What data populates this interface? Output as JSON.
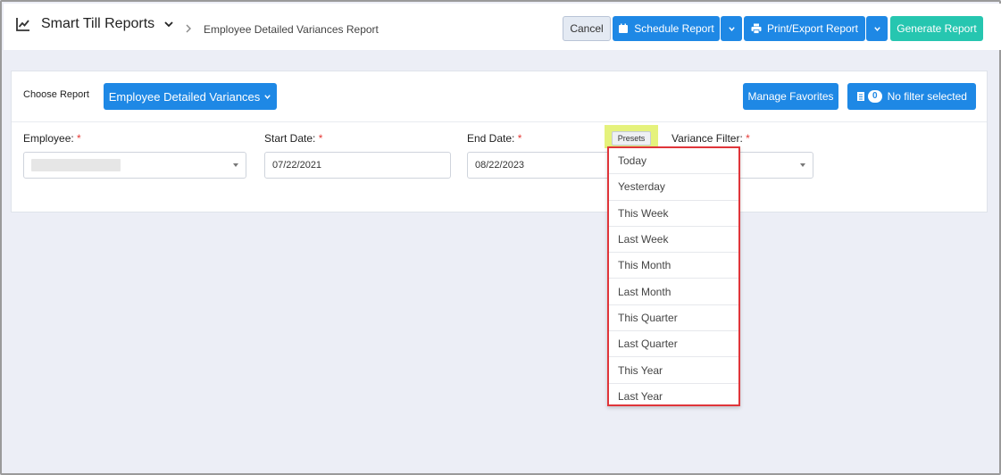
{
  "header": {
    "app_title": "Smart Till Reports",
    "breadcrumb": "Employee Detailed Variances Report",
    "cancel_label": "Cancel",
    "schedule_label": "Schedule Report",
    "print_label": "Print/Export Report",
    "generate_label": "Generate Report"
  },
  "panel": {
    "choose_label": "Choose Report",
    "report_selected": "Employee Detailed Variances",
    "manage_favorites_label": "Manage Favorites",
    "filter_count": "0",
    "filter_label": "No filter selected",
    "required_marker": "*",
    "employee_label": "Employee:",
    "start_date_label": "Start Date:",
    "start_date_value": "07/22/2021",
    "end_date_label": "End Date:",
    "end_date_value": "08/22/2023",
    "presets_label": "Presets",
    "variance_filter_label": "Variance Filter:"
  },
  "presets_menu": {
    "items": [
      "Today",
      "Yesterday",
      "This Week",
      "Last Week",
      "This Month",
      "Last Month",
      "This Quarter",
      "Last Quarter",
      "This Year",
      "Last Year"
    ]
  },
  "colors": {
    "primary": "#1e88e5",
    "accent_teal": "#26c6b0",
    "required": "#e53935",
    "highlight": "#e5f27c",
    "dropdown_border": "#e0353a"
  }
}
